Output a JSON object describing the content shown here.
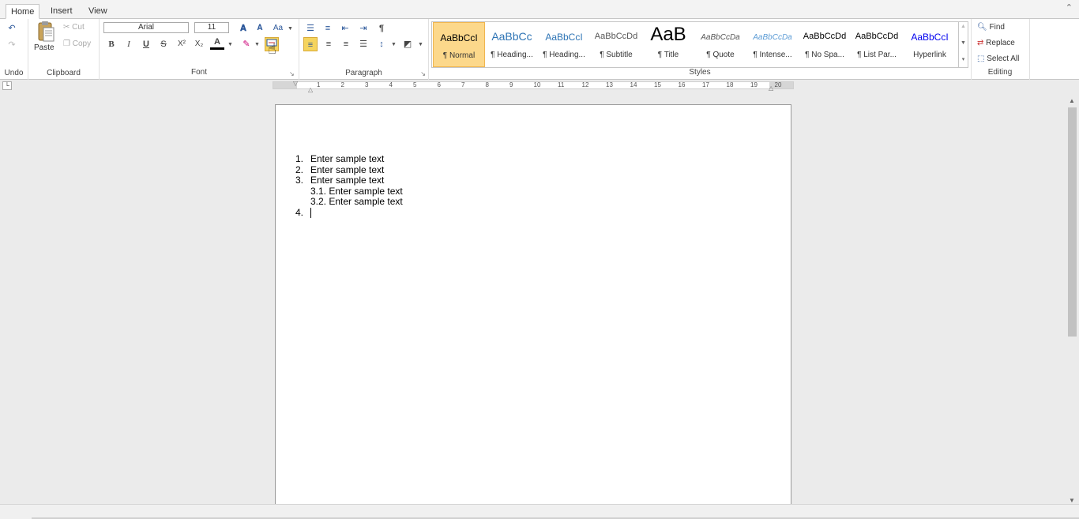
{
  "tabs": [
    "Home",
    "Insert",
    "View"
  ],
  "ribbon": {
    "undo_group": {
      "label": "Undo"
    },
    "clipboard": {
      "label": "Clipboard",
      "paste": "Paste",
      "cut": "Cut",
      "copy": "Copy"
    },
    "font": {
      "label": "Font",
      "font_name": "Arial",
      "font_size": "11",
      "bold": "B",
      "italic": "I",
      "underline": "U",
      "strike": "S",
      "superscript": "X²",
      "subscript": "X₂",
      "font_color_letter": "A"
    },
    "paragraph": {
      "label": "Paragraph"
    },
    "styles": {
      "label": "Styles",
      "items": [
        {
          "sample": "AaBbCcI",
          "name": "¶ Normal"
        },
        {
          "sample": "AaBbCc",
          "name": "¶ Heading..."
        },
        {
          "sample": "AaBbCcI",
          "name": "¶ Heading..."
        },
        {
          "sample": "AaBbCcDd",
          "name": "¶ Subtitle"
        },
        {
          "sample": "AaB",
          "name": "¶ Title"
        },
        {
          "sample": "AaBbCcDa",
          "name": "¶ Quote"
        },
        {
          "sample": "AaBbCcDa",
          "name": "¶ Intense..."
        },
        {
          "sample": "AaBbCcDd",
          "name": "¶ No Spa..."
        },
        {
          "sample": "AaBbCcDd",
          "name": "¶ List Par..."
        },
        {
          "sample": "AaBbCcI",
          "name": "Hyperlink"
        }
      ]
    },
    "editing": {
      "label": "Editing",
      "find": "Find",
      "replace": "Replace",
      "select_all": "Select All"
    }
  },
  "ruler": {
    "numbers": [
      "1",
      "2",
      "3",
      "4",
      "5",
      "6",
      "7",
      "8",
      "9",
      "10",
      "11",
      "12",
      "13",
      "14",
      "15",
      "16",
      "17",
      "18",
      "19",
      "20"
    ]
  },
  "document": {
    "lines": [
      {
        "num": "1.",
        "text": "Enter sample text"
      },
      {
        "num": "2.",
        "text": "Enter sample text"
      },
      {
        "num": "3.",
        "text": "Enter sample text"
      },
      {
        "num": "",
        "text": "3.1. Enter sample text"
      },
      {
        "num": "",
        "text": "3.2. Enter sample text"
      },
      {
        "num": "4.",
        "text": ""
      }
    ]
  },
  "colors": {
    "accent": "#2b579a",
    "active_style": "#fcd88b",
    "selected_button": "#f5d45e"
  }
}
